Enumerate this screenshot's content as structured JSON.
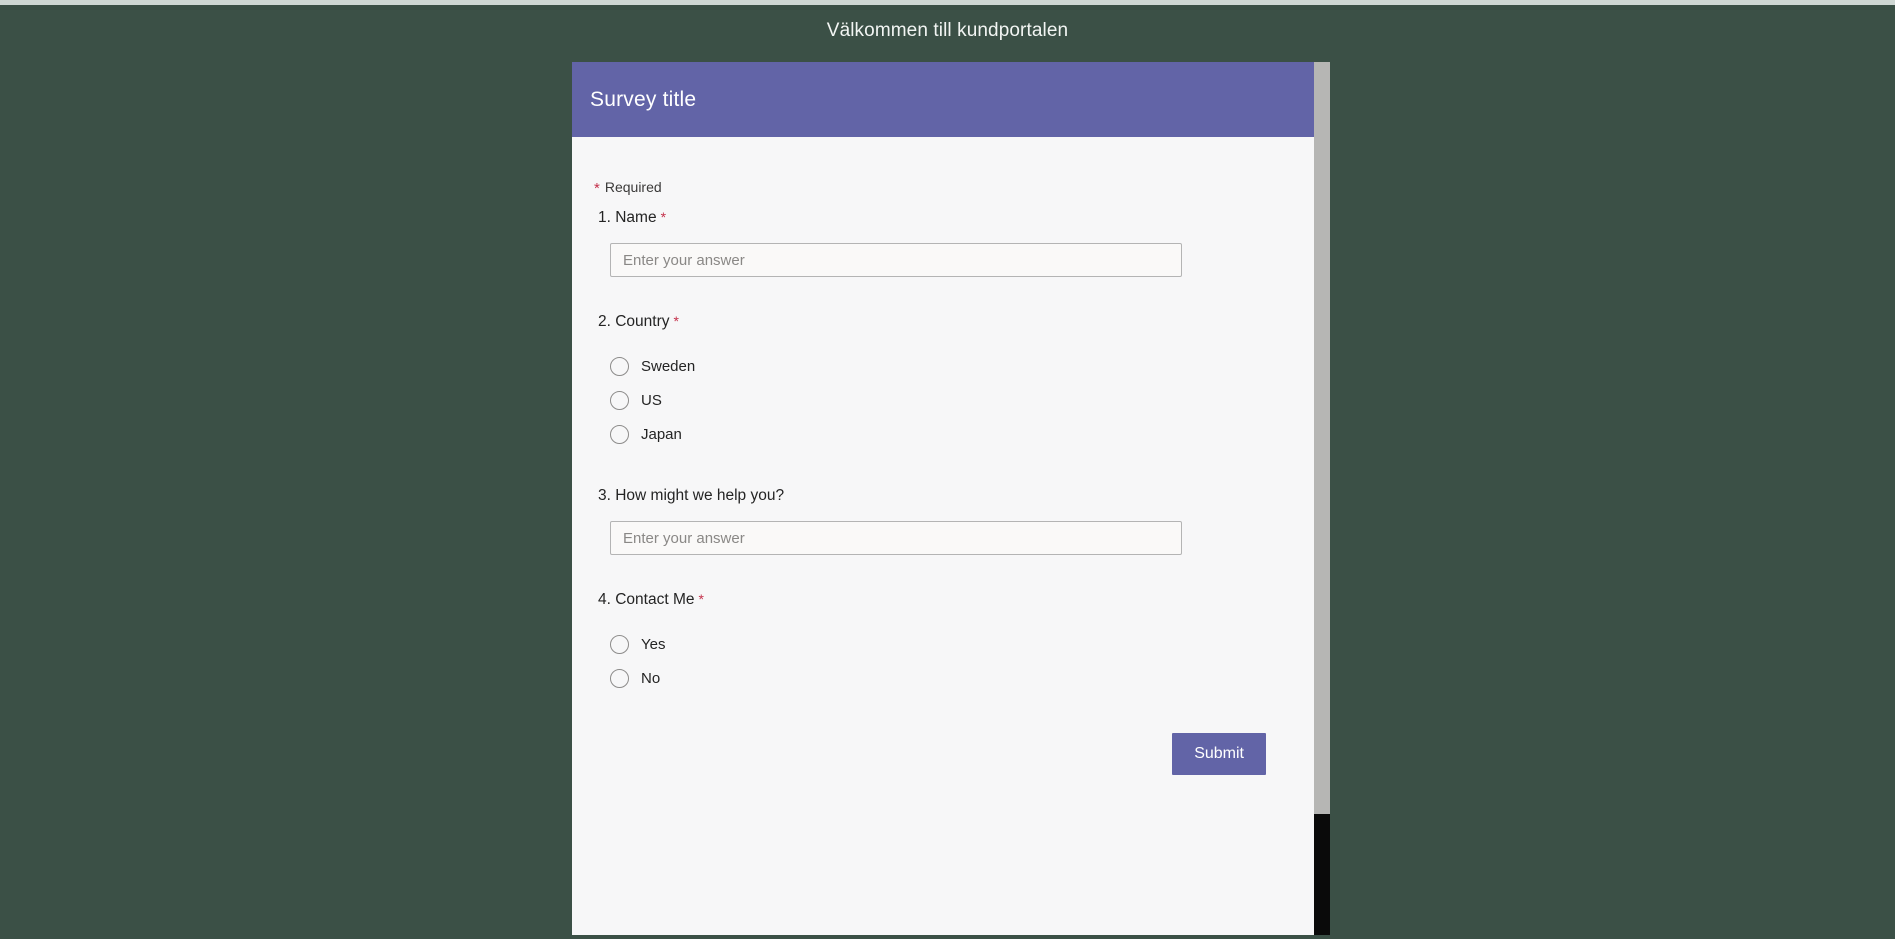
{
  "page": {
    "header_title": "Välkommen till kundportalen",
    "background_color": "#3b5046"
  },
  "survey": {
    "banner_title": "Survey title",
    "banner_color": "#6264a7",
    "required_note": "Required",
    "required_marker": "*",
    "questions": [
      {
        "label": "1. Name",
        "required": true,
        "marker": "*",
        "type": "text",
        "placeholder": "Enter your answer",
        "value": ""
      },
      {
        "label": "2. Country",
        "required": true,
        "marker": "*",
        "type": "choice",
        "options": [
          "Sweden",
          "US",
          "Japan"
        ]
      },
      {
        "label": "3. How might we help you?",
        "required": false,
        "marker": "",
        "type": "text",
        "placeholder": "Enter your answer",
        "value": ""
      },
      {
        "label": "4. Contact Me",
        "required": true,
        "marker": "*",
        "type": "choice",
        "options": [
          "Yes",
          "No"
        ]
      }
    ],
    "submit_label": "Submit"
  },
  "scrollbar": {
    "orientation": "vertical",
    "thumb_position_percent": 0
  }
}
